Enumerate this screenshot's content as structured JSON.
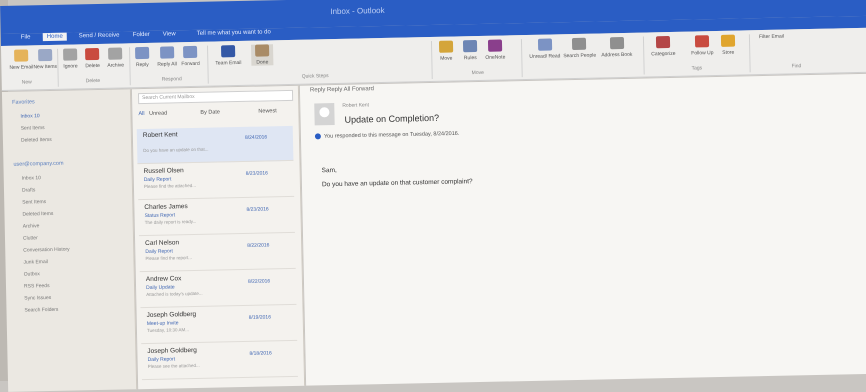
{
  "window": {
    "title": "Inbox - Outlook"
  },
  "ribbon_tabs": [
    "File",
    "Home",
    "Send / Receive",
    "Folder",
    "View",
    "Tell me what you want to do"
  ],
  "ribbon_buttons": [
    {
      "label": "New Email",
      "color": "#e5b35a"
    },
    {
      "label": "New Items",
      "color": "#9aa8c6"
    },
    {
      "label": "Ignore",
      "color": "#a3a3a3"
    },
    {
      "label": "Delete",
      "color": "#c94b3f"
    },
    {
      "label": "Archive",
      "color": "#a3a3a3"
    },
    {
      "label": "Reply",
      "color": "#7c93c4"
    },
    {
      "label": "Reply All",
      "color": "#7c93c4"
    },
    {
      "label": "Forward",
      "color": "#7c93c4"
    },
    {
      "label": "Team Email",
      "color": "#3458a6"
    },
    {
      "label": "Done",
      "color": "#a98b66"
    },
    {
      "label": "Move",
      "color": "#d4a53a"
    },
    {
      "label": "Rules",
      "color": "#6d86b4"
    },
    {
      "label": "OneNote",
      "color": "#8a3f8c"
    },
    {
      "label": "Unread/ Read",
      "color": "#7c93c4"
    },
    {
      "label": "Search People",
      "color": "#8f8f8f"
    },
    {
      "label": "Address Book",
      "color": "#8f8f8f"
    },
    {
      "label": "Filter Email",
      "color": "#8f8f8f"
    },
    {
      "label": "Categorize",
      "color": "#b44646"
    },
    {
      "label": "Follow Up",
      "color": "#c94b3f"
    },
    {
      "label": "Store",
      "color": "#e0a52e"
    }
  ],
  "ribbon_groups": [
    "New",
    "Delete",
    "Respond",
    "Quick Steps",
    "Move",
    "Tags",
    "Find"
  ],
  "folder_pane": {
    "favorites_head": "Favorites",
    "favorites": [
      "Inbox 10",
      "Sent Items",
      "Deleted Items"
    ],
    "account_head": "user@company.com",
    "folders": [
      "Inbox 10",
      "Drafts",
      "Sent Items",
      "Deleted Items",
      "Archive",
      "Clutter",
      "Conversation History",
      "Junk Email",
      "Outbox",
      "RSS Feeds",
      "Sync Issues",
      "Search Folders"
    ]
  },
  "message_list": {
    "search_placeholder": "Search Current Mailbox",
    "filter_all": "All",
    "filter_unread": "Unread",
    "sort_label": "By Date",
    "sort_dir": "Newest",
    "messages": [
      {
        "from": "Robert Kent",
        "subject": "",
        "preview": "Do you have an update on that...",
        "date": "8/24/2016"
      },
      {
        "from": "Russell Olsen",
        "subject": "Daily Report",
        "preview": "Please find the attached...",
        "date": "8/23/2016"
      },
      {
        "from": "Charles James",
        "subject": "Status Report",
        "preview": "The daily report is ready...",
        "date": "8/23/2016"
      },
      {
        "from": "Carl Nelson",
        "subject": "Daily Report",
        "preview": "Please find the report...",
        "date": "8/22/2016"
      },
      {
        "from": "Andrew Cox",
        "subject": "Daily Update",
        "preview": "Attached is today's update...",
        "date": "8/22/2016"
      },
      {
        "from": "Joseph Goldberg",
        "subject": "Meet-up Invite",
        "preview": "Tuesday, 10:30 AM...",
        "date": "8/19/2016"
      },
      {
        "from": "Joseph Goldberg",
        "subject": "Daily Report",
        "preview": "Please see the attached...",
        "date": "8/18/2016"
      }
    ]
  },
  "reading": {
    "actions": "Reply   Reply All   Forward",
    "from_line": "Robert Kent",
    "subject": "Update on Completion?",
    "info": "You responded to this message on Tuesday, 8/24/2016.",
    "greeting": "Sam,",
    "body": "Do you have an update on that customer complaint?"
  }
}
